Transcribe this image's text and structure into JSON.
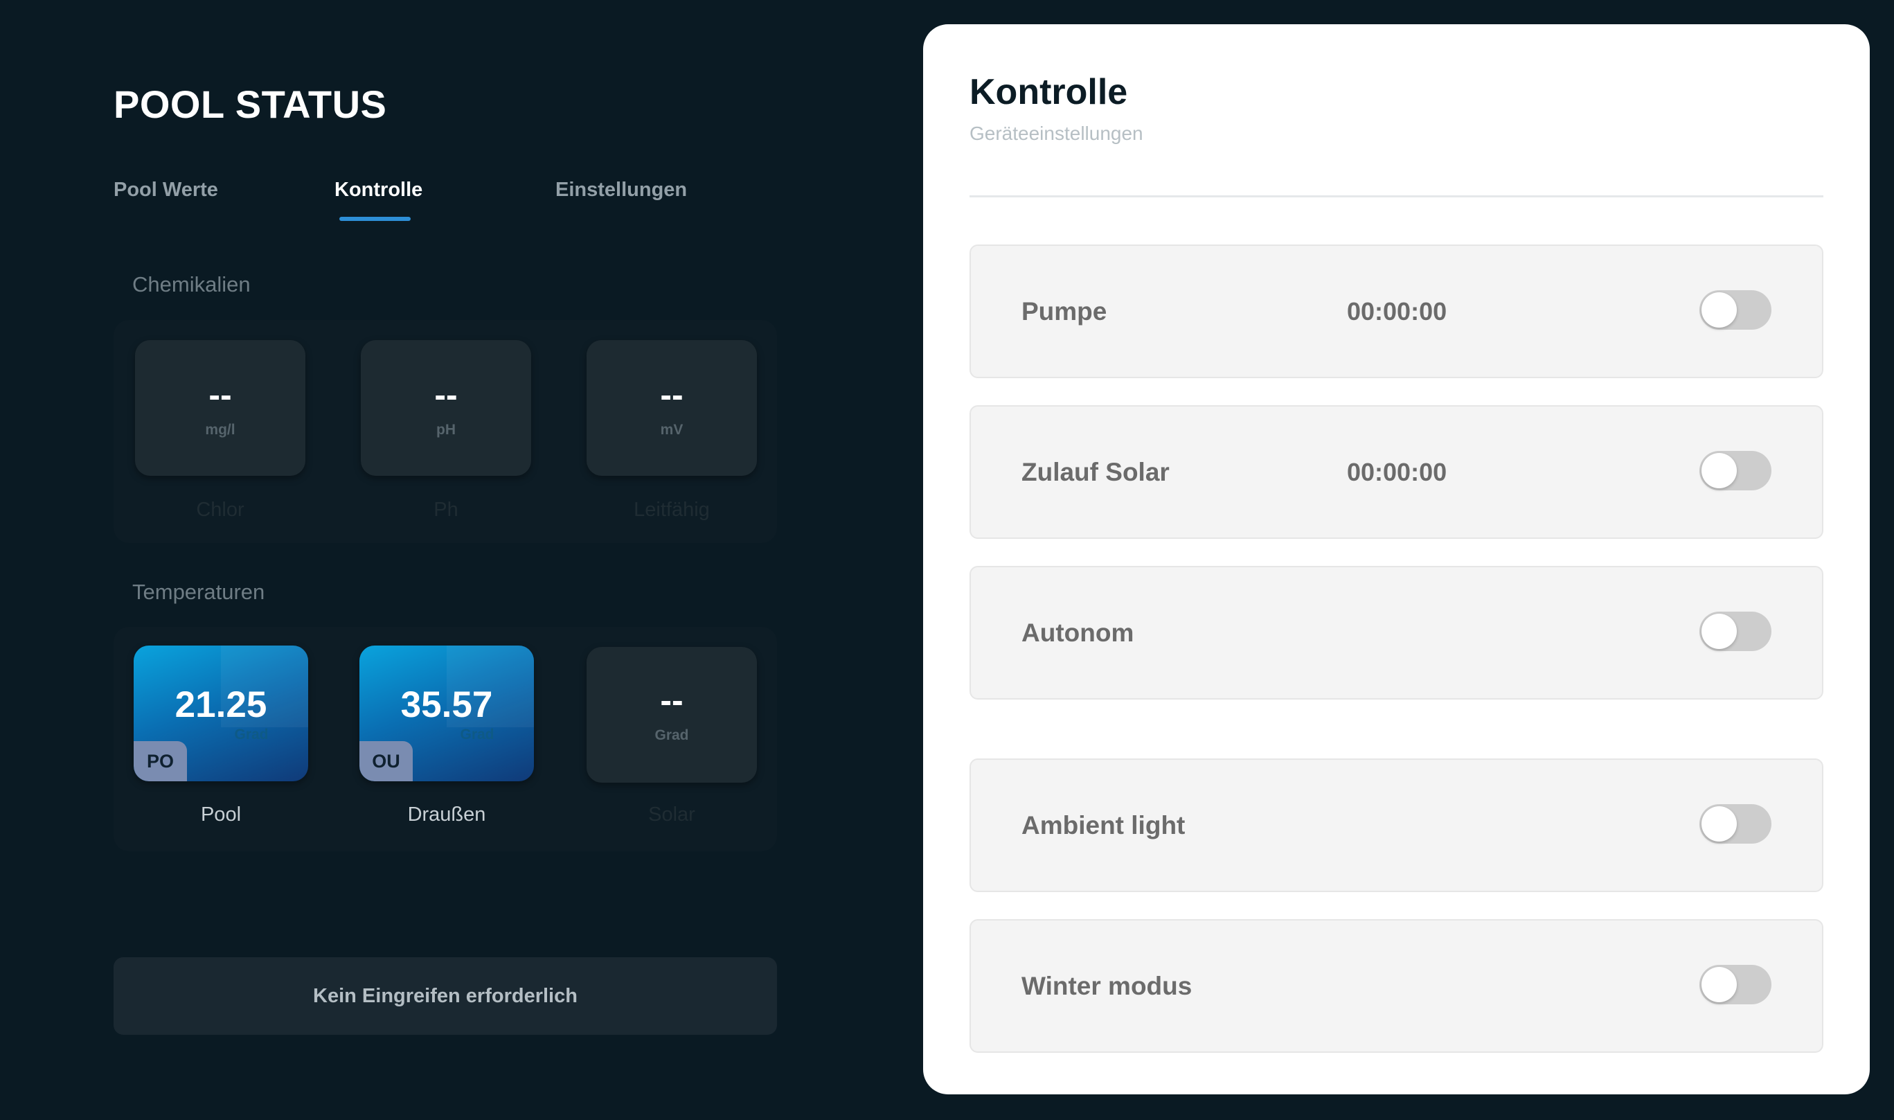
{
  "app": {
    "title": "POOL STATUS"
  },
  "tabs": [
    {
      "label": "Pool Werte",
      "active": false
    },
    {
      "label": "Kontrolle",
      "active": true
    },
    {
      "label": "Einstellungen",
      "active": false
    }
  ],
  "chemicals": {
    "section_label": "Chemikalien",
    "tiles": [
      {
        "value": "--",
        "unit": "mg/l",
        "caption": "Chlor"
      },
      {
        "value": "--",
        "unit": "pH",
        "caption": "Ph"
      },
      {
        "value": "--",
        "unit": "mV",
        "caption": "Leitfähig"
      }
    ]
  },
  "temperatures": {
    "section_label": "Temperaturen",
    "tiles": [
      {
        "value": "21.25",
        "unit": "Grad",
        "badge": "PO",
        "caption": "Pool"
      },
      {
        "value": "35.57",
        "unit": "Grad",
        "badge": "OU",
        "caption": "Draußen"
      },
      {
        "value": "--",
        "unit": "Grad",
        "caption": "Solar"
      }
    ]
  },
  "status_message": "Kein Eingreifen erforderlich",
  "control_panel": {
    "title": "Kontrolle",
    "subtitle": "Geräteeinstellungen",
    "rows": [
      {
        "label": "Pumpe",
        "time": "00:00:00",
        "enabled": false
      },
      {
        "label": "Zulauf Solar",
        "time": "00:00:00",
        "enabled": false
      },
      {
        "label": "Autonom",
        "enabled": false
      },
      {
        "label": "Ambient light",
        "enabled": false
      },
      {
        "label": "Winter modus",
        "enabled": false
      }
    ]
  },
  "colors": {
    "background": "#0a1a23",
    "accent": "#2e8fd6",
    "tile_blue": "#0a6fb3",
    "badge": "#7a8cb1"
  }
}
